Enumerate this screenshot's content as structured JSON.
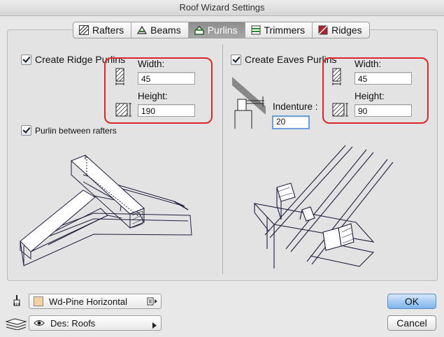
{
  "window": {
    "title": "Roof Wizard Settings"
  },
  "tabs": [
    {
      "label": "Rafters",
      "icon": "rafters-icon",
      "active": false
    },
    {
      "label": "Beams",
      "icon": "beams-icon",
      "active": false
    },
    {
      "label": "Purlins",
      "icon": "purlins-icon",
      "active": true
    },
    {
      "label": "Trimmers",
      "icon": "trimmers-icon",
      "active": false
    },
    {
      "label": "Ridges",
      "icon": "ridges-icon",
      "active": false
    }
  ],
  "ridge": {
    "checkbox_label": "Create Ridge Purlins",
    "checked": true,
    "width_label": "Width:",
    "width_value": "45",
    "height_label": "Height:",
    "height_value": "190",
    "between_rafters_label": "Purlin between rafters",
    "between_rafters_checked": true
  },
  "eaves": {
    "checkbox_label": "Create Eaves Purlins",
    "checked": true,
    "width_label": "Width:",
    "width_value": "45",
    "height_label": "Height:",
    "height_value": "90",
    "indenture_label": "Indenture :",
    "indenture_value": "20"
  },
  "material": {
    "label": "Wd-Pine Horizontal",
    "swatch_color": "#f3d3a0"
  },
  "layer": {
    "label": "Des: Roofs"
  },
  "buttons": {
    "ok": "OK",
    "cancel": "Cancel"
  },
  "colors": {
    "highlight": "#d9272a",
    "drawing_line": "#2a2a6e"
  }
}
